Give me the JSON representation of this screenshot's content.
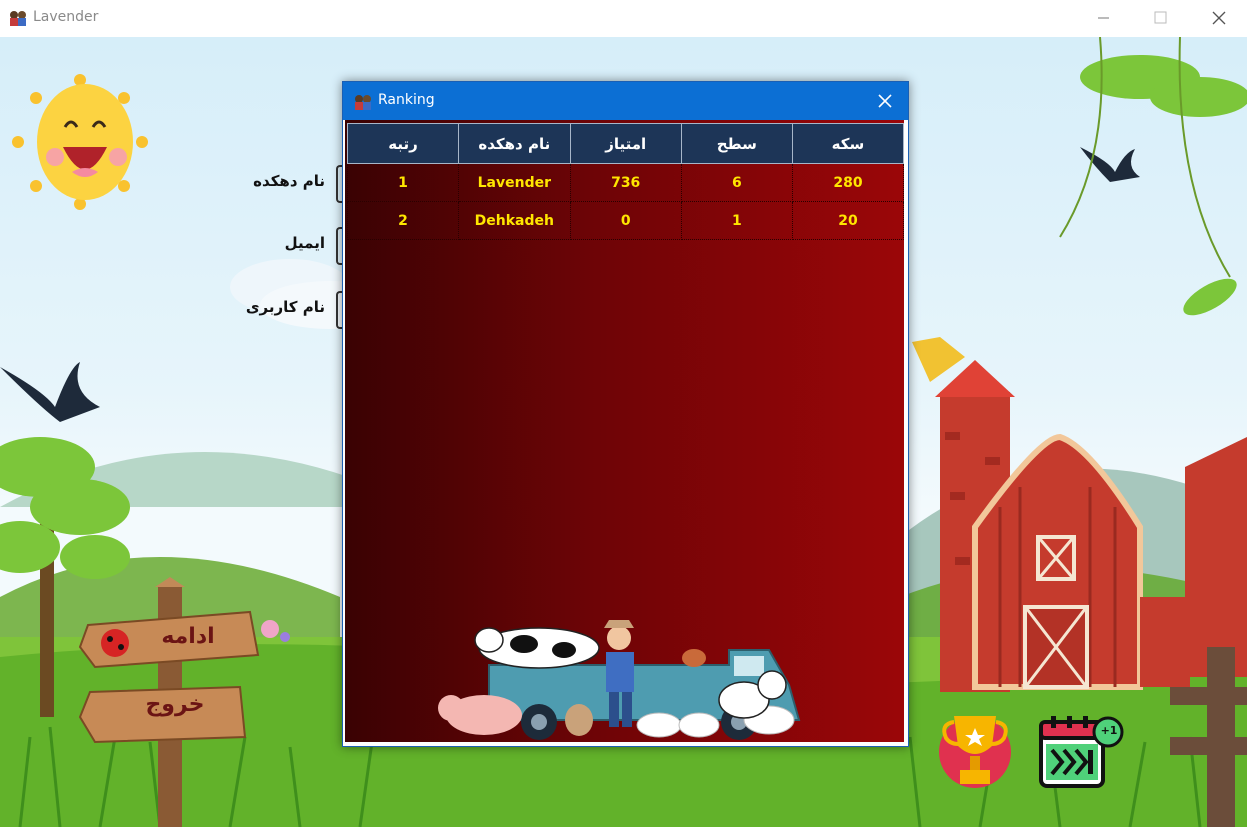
{
  "window": {
    "title": "Lavender"
  },
  "form": {
    "village_name_label": "نام دهکده",
    "email_label": "ایمیل",
    "username_label": "نام کاربری"
  },
  "signs": {
    "continue_label": "ادامه",
    "exit_label": "خروج"
  },
  "ranking_dialog": {
    "title": "Ranking",
    "columns": [
      "رتبه",
      "نام دهکده",
      "امتیاز",
      "سطح",
      "سکه"
    ],
    "rows": [
      {
        "rank": "1",
        "village": "Lavender",
        "score": "736",
        "level": "6",
        "coins": "280"
      },
      {
        "rank": "2",
        "village": "Dehkadeh",
        "score": "0",
        "level": "1",
        "coins": "20"
      }
    ]
  },
  "calendar_badge": "+1",
  "icons": {
    "app": "farm-family-icon",
    "minimize": "minimize-icon",
    "maximize": "maximize-icon",
    "close": "close-icon",
    "trophy": "trophy-icon",
    "daily_reward": "calendar-forward-icon"
  },
  "colors": {
    "dialog_title_bar": "#0c6fd4",
    "table_header": "#1d3557",
    "table_text": "#ffe600",
    "dialog_background": "#8a0507"
  }
}
